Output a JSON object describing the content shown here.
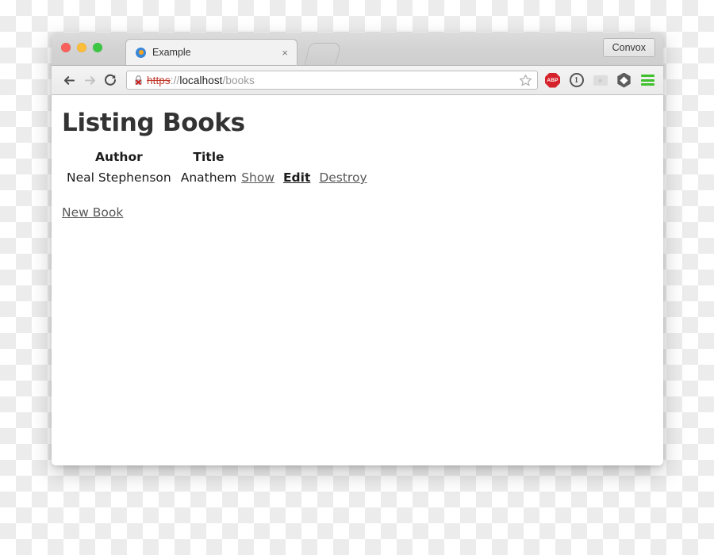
{
  "window": {
    "traffic_lights": [
      "close",
      "minimize",
      "zoom"
    ],
    "colors": {
      "close": "#f9615c",
      "minimize": "#fbbd3a",
      "zoom": "#3dc644",
      "accent_green": "#3fc02c",
      "abp_red": "#d6232b",
      "scheme_red": "#c0392b"
    }
  },
  "titlebar": {
    "tab": {
      "title": "Example",
      "favicon": "circle-favicon",
      "close_label": "×"
    },
    "new_tab_label": "+",
    "convox_button": "Convox"
  },
  "toolbar": {
    "back_label": "Back",
    "forward_label": "Forward",
    "reload_label": "Reload",
    "url": {
      "scheme": "https",
      "separator": "://",
      "host": "localhost",
      "path": "/books",
      "full": "https://localhost/books",
      "security": "insecure"
    },
    "bookmark_label": "Bookmark this page",
    "extensions": [
      {
        "name": "adblock-plus",
        "label": "ABP"
      },
      {
        "name": "1password",
        "label": "1"
      },
      {
        "name": "disabled-extension",
        "label": "a"
      },
      {
        "name": "hexagon-extension",
        "label": ""
      },
      {
        "name": "menu",
        "label": ""
      }
    ]
  },
  "page": {
    "title": "Listing Books",
    "table": {
      "headers": [
        "Author",
        "Title"
      ],
      "rows": [
        {
          "author": "Neal Stephenson",
          "title": "Anathem",
          "actions": [
            "Show",
            "Edit",
            "Destroy"
          ]
        }
      ]
    },
    "new_book_link": "New Book"
  }
}
